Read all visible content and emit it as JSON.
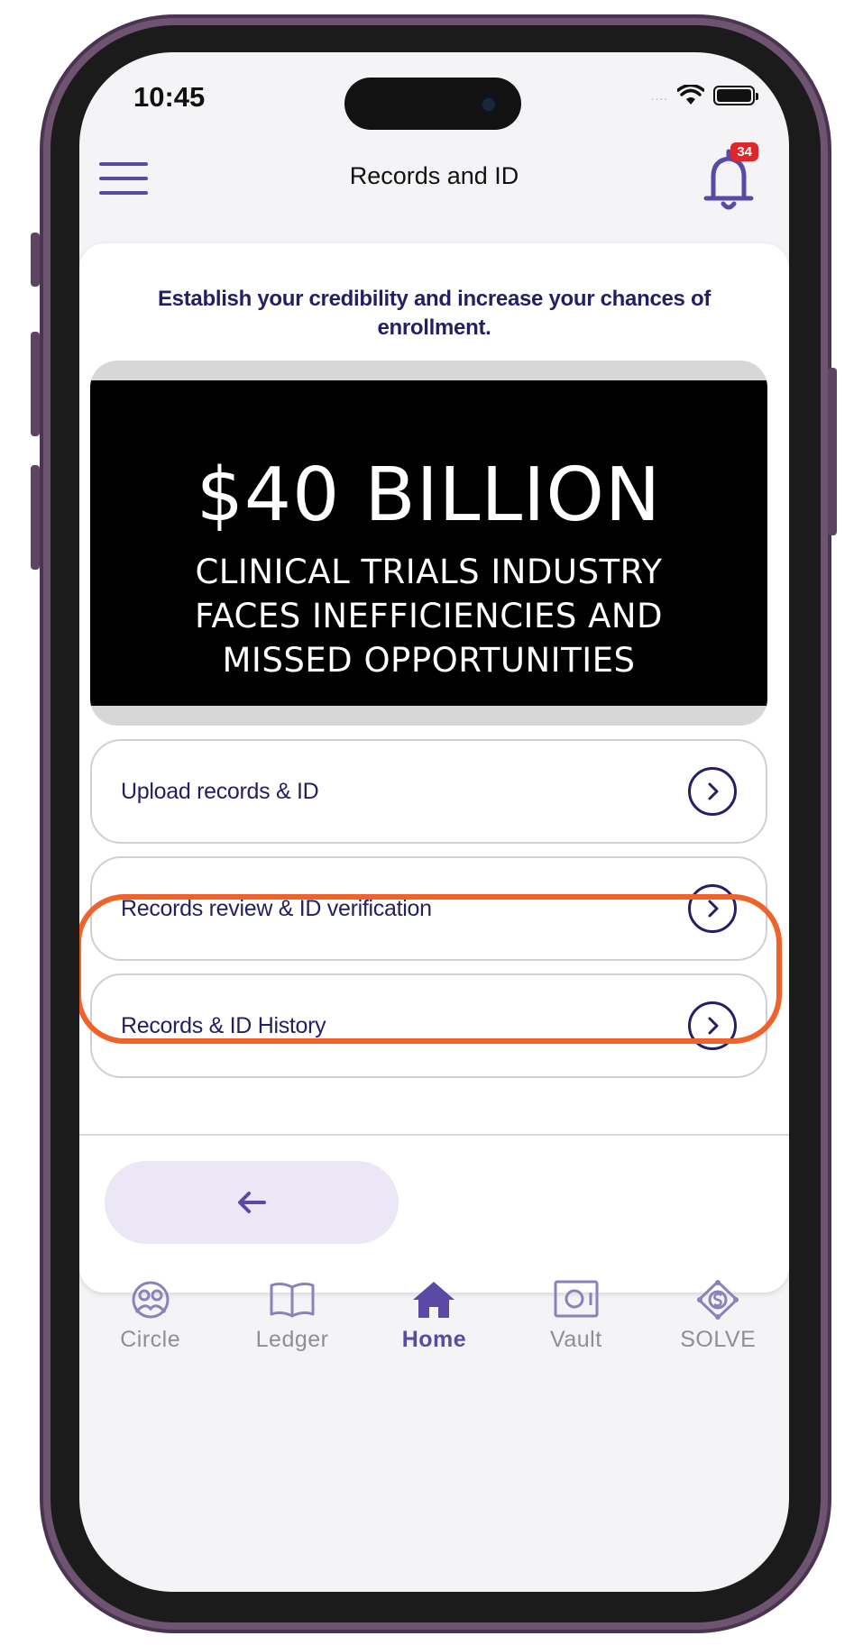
{
  "status_bar": {
    "time": "10:45",
    "signal": "....",
    "wifi_icon": "wifi-icon",
    "battery_icon": "battery-icon"
  },
  "header": {
    "title": "Records and ID",
    "notification_count": "34"
  },
  "colors": {
    "accent": "#5a4aa6",
    "text_dark": "#231f63",
    "highlight": "#f0622a",
    "badge": "#e0262b"
  },
  "intro_text": "Establish your credibility and increase your chances of enrollment.",
  "video": {
    "headline": "$40 BILLION",
    "subline": [
      "CLINICAL TRIALS INDUSTRY",
      "FACES INEFFICIENCIES AND",
      "MISSED OPPORTUNITIES"
    ]
  },
  "options": [
    {
      "label": "Upload records & ID"
    },
    {
      "label": "Records review & ID verification"
    },
    {
      "label": "Records & ID History"
    }
  ],
  "back_button": {
    "icon": "arrow-left-icon"
  },
  "tabs": [
    {
      "label": "Circle",
      "icon": "circle-icon"
    },
    {
      "label": "Ledger",
      "icon": "ledger-book-icon"
    },
    {
      "label": "Home",
      "icon": "home-icon",
      "active": true
    },
    {
      "label": "Vault",
      "icon": "vault-icon"
    },
    {
      "label": "SOLVE",
      "icon": "solve-icon"
    }
  ]
}
